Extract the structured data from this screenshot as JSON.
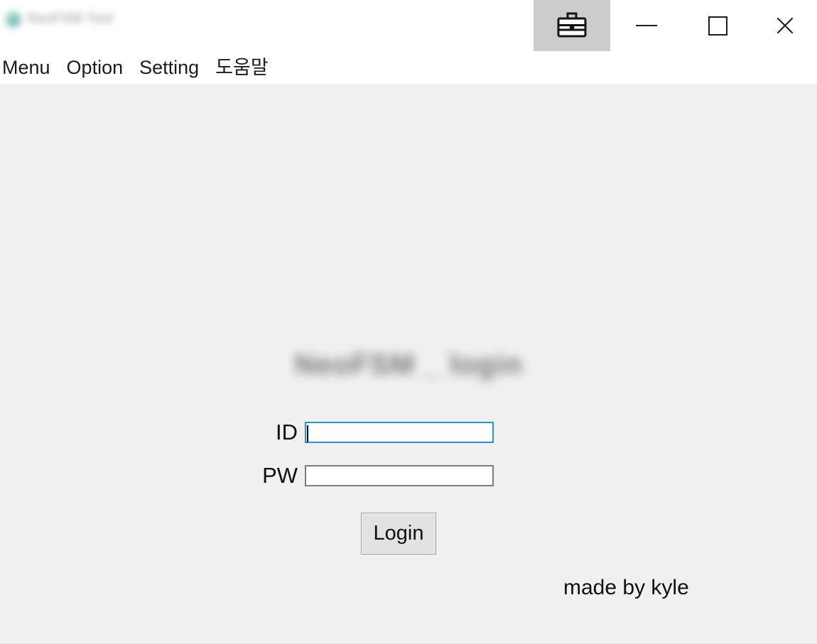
{
  "window": {
    "title": "NeoFSM Tool",
    "logo_icon": "teal-circle-logo-icon",
    "controls": {
      "briefcase_icon": "briefcase-icon",
      "minimize_icon": "minimize-icon",
      "maximize_icon": "maximize-icon",
      "close_icon": "close-icon"
    }
  },
  "menu_bar": {
    "items": [
      {
        "label": "Menu"
      },
      {
        "label": "Option"
      },
      {
        "label": "Setting"
      },
      {
        "label": "도움말"
      }
    ]
  },
  "login": {
    "heading": "NeoFSM _ login",
    "id_label": "ID",
    "id_value": "",
    "id_placeholder": "",
    "pw_label": "PW",
    "pw_value": "",
    "pw_placeholder": "",
    "submit_label": "Login",
    "credit": "made by kyle"
  },
  "colors": {
    "window_background": "#f0f0f0",
    "title_bar_background": "#ffffff",
    "briefcase_button_background": "#cccccc",
    "focus_border": "#2f8fd7",
    "input_border": "#7d7d7d",
    "button_face": "#e2e2e2",
    "text": "#101010"
  }
}
